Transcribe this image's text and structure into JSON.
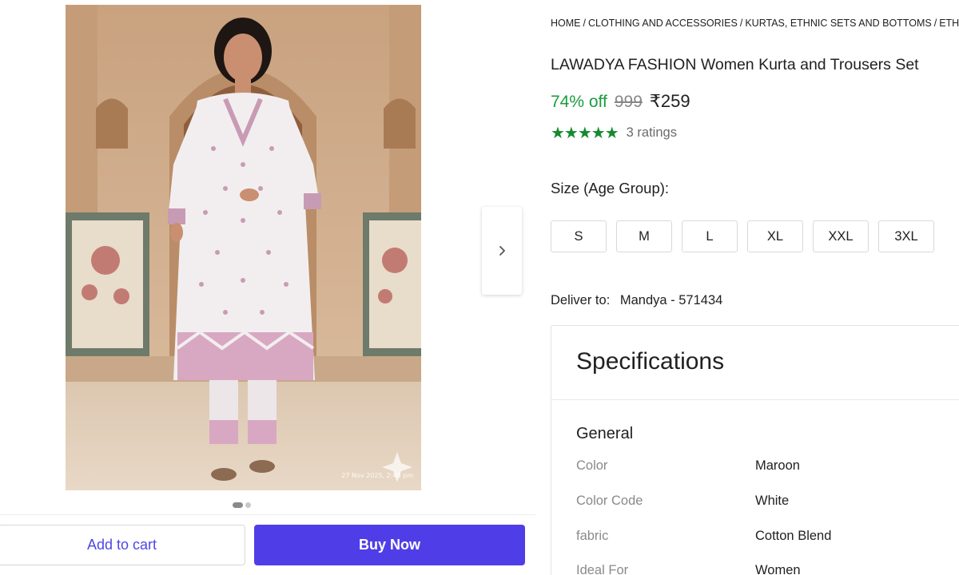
{
  "breadcrumb": [
    "HOME",
    "CLOTHING AND ACCESSORIES",
    "KURTAS, ETHNIC SETS AND BOTTOMS",
    "ETH"
  ],
  "product": {
    "title": "LAWADYA FASHION Women Kurta and Trousers Set",
    "discount": "74% off",
    "mrp": "999",
    "price": "₹259",
    "stars": "★★★★★",
    "rating_count": "3 ratings",
    "image_watermark": "27 Nov 2025, 2:40 pm"
  },
  "size": {
    "label": "Size (Age Group):",
    "options": [
      "S",
      "M",
      "L",
      "XL",
      "XXL",
      "3XL"
    ]
  },
  "delivery": {
    "label": "Deliver to:",
    "location": "Mandya - 571434"
  },
  "specifications": {
    "title": "Specifications",
    "section": "General",
    "rows": [
      {
        "key": "Color",
        "value": "Maroon"
      },
      {
        "key": "Color Code",
        "value": "White"
      },
      {
        "key": "fabric",
        "value": "Cotton Blend"
      },
      {
        "key": "Ideal For",
        "value": "Women"
      }
    ]
  },
  "actions": {
    "add_to_cart": "Add to cart",
    "buy_now": "Buy Now"
  },
  "carousel": {
    "current": 1,
    "total": 2
  },
  "icons": {
    "next": "chevron-right-icon"
  },
  "colors": {
    "accent": "#4f3ee8",
    "accent_text": "#4f46e5",
    "discount": "#1a9c3d",
    "stars": "#138a2e"
  }
}
